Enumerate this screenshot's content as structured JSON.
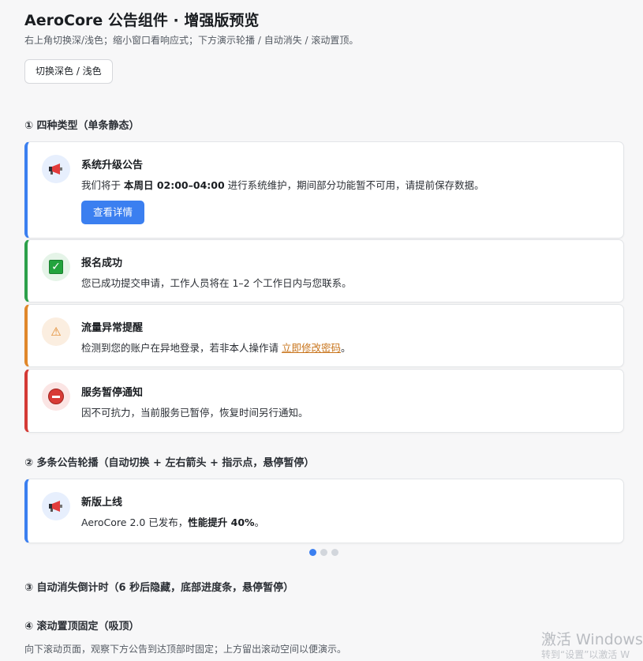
{
  "header": {
    "title": "AeroCore 公告组件 · 增强版预览",
    "subtitle": "右上角切换深/浅色；缩小窗口看响应式；下方演示轮播 / 自动消失 / 滚动置顶。",
    "toggle_label": "切换深色 / 浅色"
  },
  "sections": {
    "s1_title": "① 四种类型（单条静态）",
    "s2_title": "② 多条公告轮播（自动切换 + 左右箭头 + 指示点，悬停暂停）",
    "s3_title": "③ 自动消失倒计时（6 秒后隐藏，底部进度条，悬停暂停）",
    "s4_title": "④ 滚动置顶固定（吸顶）",
    "s4_desc": "向下滚动页面，观察下方公告到达顶部时固定；上方留出滚动空间以便演示。"
  },
  "cards": {
    "info": {
      "title": "系统升级公告",
      "body_pre": "我们将于 ",
      "body_bold": "本周日 02:00–04:00",
      "body_post": " 进行系统维护，期间部分功能暂不可用，请提前保存数据。",
      "button": "查看详情",
      "icon": "megaphone-icon"
    },
    "success": {
      "title": "报名成功",
      "body": "您已成功提交申请，工作人员将在 1–2 个工作日内与您联系。",
      "icon": "check-icon"
    },
    "warning": {
      "title": "流量异常提醒",
      "body_pre": "检测到您的账户在异地登录，若非本人操作请 ",
      "link": "立即修改密码",
      "body_post": "。",
      "icon": "warning-icon"
    },
    "error": {
      "title": "服务暂停通知",
      "body": "因不可抗力，当前服务已暂停，恢复时间另行通知。",
      "icon": "no-entry-icon"
    },
    "carousel": {
      "title": "新版上线",
      "body_pre": "AeroCore 2.0 已发布，",
      "body_bold": "性能提升 40%",
      "body_post": "。",
      "icon": "megaphone-icon",
      "active_index": 0,
      "total": 3
    }
  },
  "watermark": {
    "line1": "激活 Windows",
    "line2": "转到“设置”以激活 W"
  },
  "colors": {
    "info": "#3b7ff0",
    "success": "#2ca04a",
    "warning": "#e0872a",
    "error": "#d43a36"
  }
}
